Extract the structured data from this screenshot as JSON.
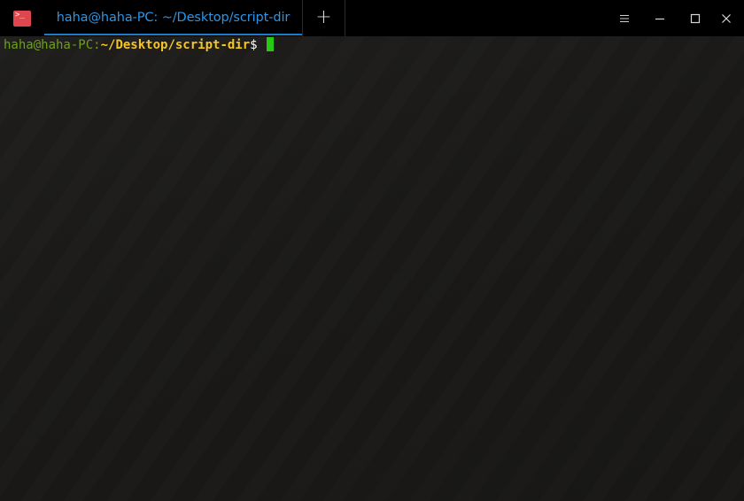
{
  "app": {
    "icon": "terminal-icon",
    "icon_glyph": ">_",
    "accent_color": "#2c95e6"
  },
  "tabs": [
    {
      "label": "haha@haha-PC: ~/Desktop/script-dir",
      "active": true
    }
  ],
  "controls": {
    "new_tab": "+",
    "menu": "hamburger-menu-icon",
    "minimize": "minimize-icon",
    "maximize": "maximize-icon",
    "close": "close-icon"
  },
  "terminal": {
    "prompt_user": "haha@haha-PC",
    "prompt_sep": ":",
    "prompt_path": "~/Desktop/script-dir",
    "prompt_symbol": "$",
    "colors": {
      "user": "#6e9f1c",
      "path": "#f3c623",
      "cursor": "#28c814",
      "background": "#1b1a18"
    }
  }
}
